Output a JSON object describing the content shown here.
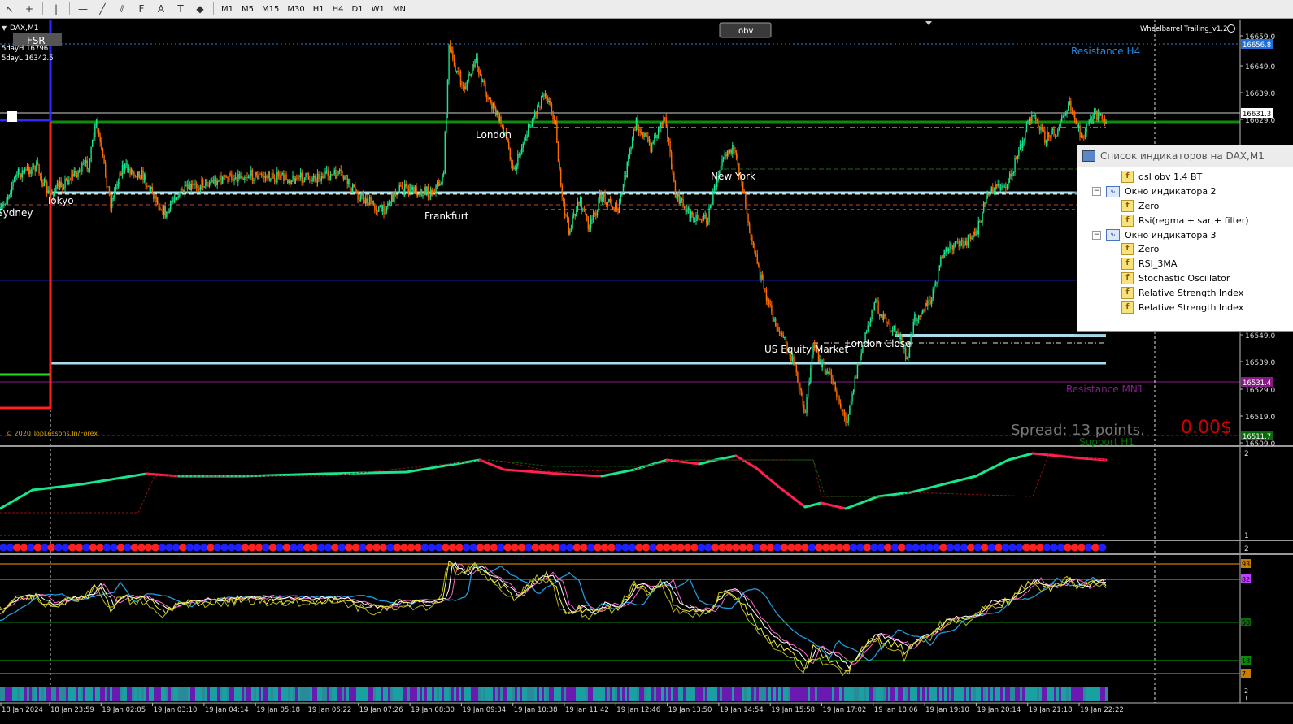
{
  "toolbar": {
    "tools": [
      {
        "name": "cursor-icon",
        "glyph": "↖"
      },
      {
        "name": "crosshair-icon",
        "glyph": "+"
      },
      {
        "name": "vertical-line-icon",
        "glyph": "|"
      },
      {
        "name": "horizontal-line-icon",
        "glyph": "—"
      },
      {
        "name": "trendline-icon",
        "glyph": "╱"
      },
      {
        "name": "channel-icon",
        "glyph": "⫽"
      },
      {
        "name": "fibonacci-icon",
        "glyph": "F"
      },
      {
        "name": "text-icon",
        "glyph": "A"
      },
      {
        "name": "text-label-icon",
        "glyph": "T"
      },
      {
        "name": "shapes-icon",
        "glyph": "◆"
      }
    ],
    "timeframes": [
      "M1",
      "M5",
      "M15",
      "M30",
      "H1",
      "H4",
      "D1",
      "W1",
      "MN"
    ]
  },
  "chart": {
    "symbol": "DAX,M1",
    "fsr_label": "FSR",
    "fiveday_high": "5dayH 16796",
    "fiveday_low": "5dayL 16342.5",
    "obv_button": "obv",
    "ea_label": "Wheelbarrel Trailing_v1.2",
    "copyright": "© 2020 TopLessons.In/Forex",
    "spread": "Spread: 13 points.",
    "profit": "0.00$",
    "levels": {
      "resistance_h4": "Resistance H4",
      "resistance_mn1": "Resistance MN1",
      "support_h1": "Support H1"
    },
    "sessions": {
      "sydney": "Sydney",
      "tokyo": "Tokyo",
      "frankfurt": "Frankfurt",
      "london": "London",
      "new_york": "New York",
      "us_equity": "US Equity Market",
      "london_close": "London Close"
    },
    "price_scale": [
      "16659.0",
      "16649.0",
      "16639.0",
      "16629.0",
      "16549.0",
      "16539.0",
      "16529.0",
      "16519.0",
      "16509.0"
    ],
    "price_tags": [
      {
        "text": "16656.8",
        "bg": "#1e6fd9",
        "fg": "#ffffff"
      },
      {
        "text": "16631.3",
        "bg": "#ffffff",
        "fg": "#000000"
      },
      {
        "text": "16531.4",
        "bg": "#8a1a8a",
        "fg": "#ffffff"
      },
      {
        "text": "16511.7",
        "bg": "#0a6a0a",
        "fg": "#ffffff"
      }
    ],
    "osc1_scale": [
      "2",
      "1"
    ],
    "dots_scale": [
      "2"
    ],
    "osc3_scale": [
      "93",
      "82",
      "50",
      "18",
      "7"
    ],
    "bottom_scale": [
      "2",
      "1"
    ],
    "time_axis": [
      "18 Jan 2024",
      "18 Jan 23:59",
      "19 Jan 02:05",
      "19 Jan 03:10",
      "19 Jan 04:14",
      "19 Jan 05:18",
      "19 Jan 06:22",
      "19 Jan 07:26",
      "19 Jan 08:30",
      "19 Jan 09:34",
      "19 Jan 10:38",
      "19 Jan 11:42",
      "19 Jan 12:46",
      "19 Jan 13:50",
      "19 Jan 14:54",
      "19 Jan 15:58",
      "19 Jan 17:02",
      "19 Jan 18:06",
      "19 Jan 19:10",
      "19 Jan 20:14",
      "19 Jan 21:18",
      "19 Jan 22:22"
    ]
  },
  "indicator_panel": {
    "title": "Список индикаторов на DAX,M1",
    "rows": [
      {
        "label": "dsl obv 1.4 BT",
        "kind": "indicator",
        "level": 1
      },
      {
        "label": "Окно индикатора 2",
        "kind": "window",
        "level": 0
      },
      {
        "label": "Zero",
        "kind": "indicator",
        "level": 1
      },
      {
        "label": "Rsi(regma + sar + filter)",
        "kind": "indicator",
        "level": 1
      },
      {
        "label": "Окно индикатора 3",
        "kind": "window",
        "level": 0
      },
      {
        "label": "Zero",
        "kind": "indicator",
        "level": 1
      },
      {
        "label": "RSI_3MA",
        "kind": "indicator",
        "level": 1
      },
      {
        "label": "Stochastic Oscillator",
        "kind": "indicator",
        "level": 1
      },
      {
        "label": "Relative Strength Index",
        "kind": "indicator",
        "level": 1
      },
      {
        "label": "Relative Strength Index",
        "kind": "indicator",
        "level": 1
      }
    ]
  },
  "colors": {
    "bull": "#19e68c",
    "bear": "#ff6a00",
    "resistance_h4": "#1e90ff",
    "resistance_mn1": "#8a1a8a",
    "support_h1": "#0a6a0a",
    "ice": "#a8dcf0"
  }
}
